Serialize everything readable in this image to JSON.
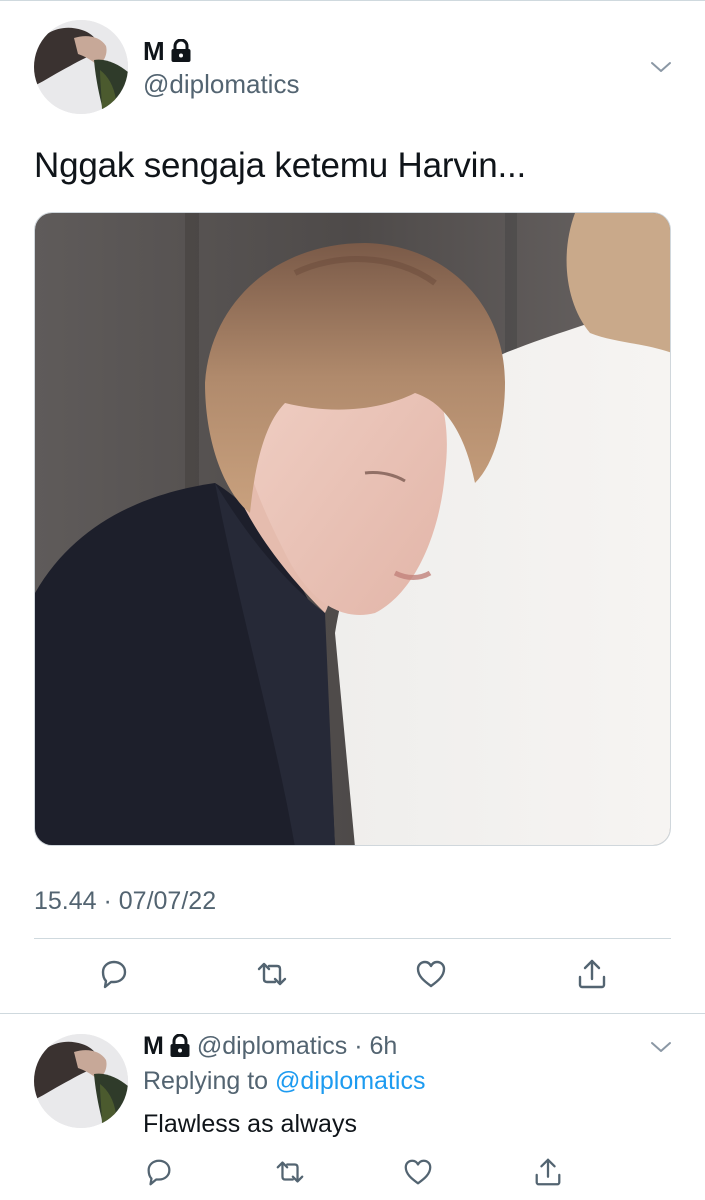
{
  "tweet": {
    "display_name": "M",
    "handle": "@diplomatics",
    "text": "Nggak sengaja ketemu Harvin...",
    "timestamp": "15.44 · 07/07/22",
    "media": {
      "description_icon": "photo"
    }
  },
  "actions": [
    "reply-icon",
    "retweet-icon",
    "like-icon",
    "share-icon"
  ],
  "reply": {
    "display_name": "M",
    "handle_time": "@diplomatics · 6h",
    "replying_prefix": "Replying to ",
    "replying_to": "@diplomatics",
    "text": "Flawless as always"
  },
  "colors": {
    "text_primary": "#0f1419",
    "text_secondary": "#536471",
    "link": "#1d9bf0",
    "divider": "#cfd9de"
  }
}
